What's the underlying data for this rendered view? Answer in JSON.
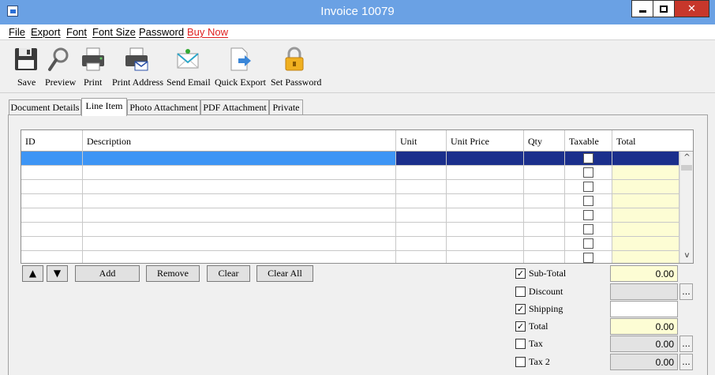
{
  "window": {
    "title": "Invoice 10079",
    "min_icon": "minimize-icon",
    "max_icon": "maximize-icon",
    "close_icon": "close-icon",
    "close_glyph": "✕"
  },
  "menu": {
    "items": [
      "File",
      "Export",
      "Font",
      "Font Size",
      "Password",
      "Buy Now"
    ],
    "buy_now_color": "#e02020"
  },
  "toolbar": {
    "items": [
      {
        "label": "Save",
        "icon": "floppy-disk-icon"
      },
      {
        "label": "Preview",
        "icon": "magnifier-icon"
      },
      {
        "label": "Print",
        "icon": "printer-icon"
      },
      {
        "label": "Print Address",
        "icon": "printer-envelope-icon"
      },
      {
        "label": "Send Email",
        "icon": "email-icon"
      },
      {
        "label": "Quick Export",
        "icon": "export-document-icon"
      },
      {
        "label": "Set Password",
        "icon": "padlock-icon"
      }
    ]
  },
  "tabs": {
    "items": [
      "Document Details",
      "Line Item",
      "Photo Attachment",
      "PDF Attachment",
      "Private"
    ],
    "active": "Line Item"
  },
  "grid": {
    "columns": [
      "ID",
      "Description",
      "Unit",
      "Unit Price",
      "Qty",
      "Taxable",
      "Total"
    ],
    "rows": [
      {
        "id": "",
        "description": "",
        "unit": "",
        "unit_price": "",
        "qty": "",
        "taxable": false,
        "total": "",
        "selected": true
      },
      {
        "id": "",
        "description": "",
        "unit": "",
        "unit_price": "",
        "qty": "",
        "taxable": false,
        "total": ""
      },
      {
        "id": "",
        "description": "",
        "unit": "",
        "unit_price": "",
        "qty": "",
        "taxable": false,
        "total": ""
      },
      {
        "id": "",
        "description": "",
        "unit": "",
        "unit_price": "",
        "qty": "",
        "taxable": false,
        "total": ""
      },
      {
        "id": "",
        "description": "",
        "unit": "",
        "unit_price": "",
        "qty": "",
        "taxable": false,
        "total": ""
      },
      {
        "id": "",
        "description": "",
        "unit": "",
        "unit_price": "",
        "qty": "",
        "taxable": false,
        "total": ""
      },
      {
        "id": "",
        "description": "",
        "unit": "",
        "unit_price": "",
        "qty": "",
        "taxable": false,
        "total": ""
      },
      {
        "id": "",
        "description": "",
        "unit": "",
        "unit_price": "",
        "qty": "",
        "taxable": false,
        "total": ""
      }
    ],
    "selected_color": "#1b2f8c",
    "selected_light_color": "#3d95f5",
    "total_cell_color": "#fdfdd4",
    "scroll_up_glyph": "^",
    "scroll_down_glyph": "v"
  },
  "row_actions": {
    "move_up_glyph": "▲",
    "move_down_glyph": "▼",
    "add_label": "Add",
    "remove_label": "Remove",
    "clear_label": "Clear",
    "clear_all_label": "Clear All"
  },
  "totals": [
    {
      "label": "Sub-Total",
      "checked": true,
      "value": "0.00",
      "style": "yellow",
      "has_button": false
    },
    {
      "label": "Discount",
      "checked": false,
      "value": "",
      "style": "gray",
      "has_button": true
    },
    {
      "label": "Shipping",
      "checked": true,
      "value": "",
      "style": "white",
      "has_button": false
    },
    {
      "label": "Total",
      "checked": true,
      "value": "0.00",
      "style": "yellow",
      "has_button": false
    },
    {
      "label": "Tax",
      "checked": false,
      "value": "0.00",
      "style": "gray",
      "has_button": true
    },
    {
      "label": "Tax 2",
      "checked": false,
      "value": "0.00",
      "style": "gray",
      "has_button": true
    }
  ],
  "totals_button_glyph": "...",
  "check_glyph": "✓"
}
